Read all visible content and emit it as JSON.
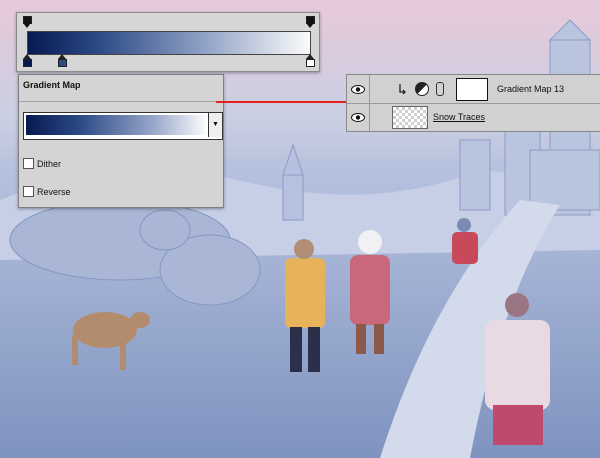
{
  "gradient_editor": {
    "colors": [
      "#071a52",
      "#2c4a86",
      "#8a9cc2",
      "#fbfbfb"
    ],
    "opacity_stops": [
      0,
      100
    ],
    "color_stops": [
      0,
      13,
      100
    ]
  },
  "gradient_map_panel": {
    "title": "Gradient Map",
    "dither_label": "Dither",
    "dither_checked": false,
    "reverse_label": "Reverse",
    "reverse_checked": false
  },
  "layers_panel": {
    "layers": [
      {
        "name": "Gradient Map 13",
        "visible": true,
        "type": "adjustment",
        "clipped": true
      },
      {
        "name": "Snow Traces",
        "visible": true,
        "type": "pixel"
      }
    ]
  },
  "scene": {
    "description_icons": [
      "eye-icon",
      "clip-arrow-icon",
      "adjustment-layer-icon",
      "chain-link-icon"
    ],
    "accent_color": "#e32020"
  }
}
